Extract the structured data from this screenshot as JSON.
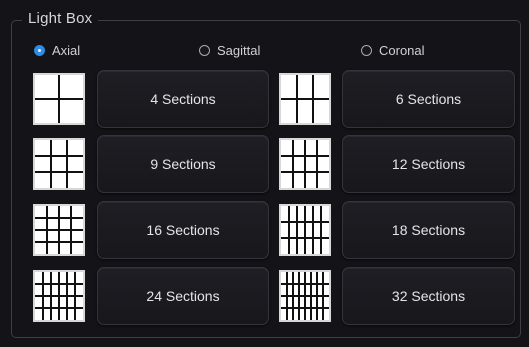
{
  "panel": {
    "title": "Light Box"
  },
  "orientation": {
    "options": [
      {
        "label": "Axial",
        "selected": true
      },
      {
        "label": "Sagittal",
        "selected": false
      },
      {
        "label": "Coronal",
        "selected": false
      }
    ]
  },
  "sections": [
    {
      "label": "4 Sections",
      "rows": 2,
      "cols": 2
    },
    {
      "label": "6 Sections",
      "rows": 2,
      "cols": 3
    },
    {
      "label": "9 Sections",
      "rows": 3,
      "cols": 3
    },
    {
      "label": "12 Sections",
      "rows": 3,
      "cols": 4
    },
    {
      "label": "16 Sections",
      "rows": 4,
      "cols": 4
    },
    {
      "label": "18 Sections",
      "rows": 3,
      "cols": 6
    },
    {
      "label": "24 Sections",
      "rows": 4,
      "cols": 6
    },
    {
      "label": "32 Sections",
      "rows": 4,
      "cols": 8
    }
  ],
  "colors": {
    "accent": "#2f8be6",
    "background": "#131318",
    "button": "#1b1b20",
    "grid_line": "#111111"
  },
  "icons": {
    "grid": "grid-layout-icon",
    "radio": "radio-button-icon"
  }
}
